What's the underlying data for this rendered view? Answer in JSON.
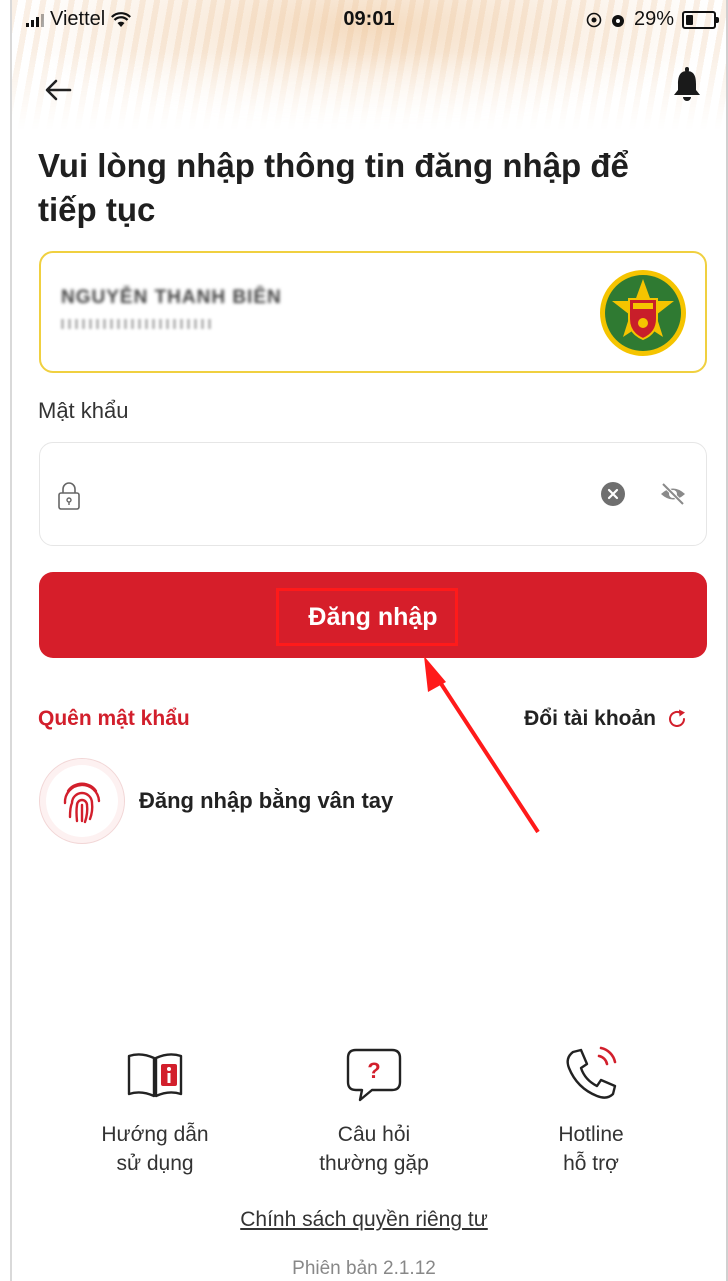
{
  "status_bar": {
    "carrier": "Viettel",
    "time": "09:01",
    "battery": "29%"
  },
  "header": {
    "title": "Vui lòng nhập thông tin đăng nhập để tiếp tục"
  },
  "account": {
    "name": "NGUYỄN THANH BIÊN"
  },
  "password": {
    "label": "Mật khẩu",
    "value": ""
  },
  "buttons": {
    "login": "Đăng nhập",
    "forgot_password": "Quên mật khẩu",
    "switch_account": "Đổi tài khoản",
    "fingerprint_login": "Đăng nhập bằng vân tay"
  },
  "footer": {
    "items": [
      {
        "line1": "Hướng dẫn",
        "line2": "sử dụng",
        "icon": "book-info-icon"
      },
      {
        "line1": "Câu hỏi",
        "line2": "thường gặp",
        "icon": "faq-bubble-icon"
      },
      {
        "line1": "Hotline",
        "line2": "hỗ trợ",
        "icon": "phone-icon"
      }
    ],
    "privacy": "Chính sách quyền riêng tư",
    "version": "Phiên bản 2.1.12"
  },
  "colors": {
    "primary": "#d61e2a",
    "account_border": "#f0d040",
    "annotation": "#ff1a1a"
  }
}
